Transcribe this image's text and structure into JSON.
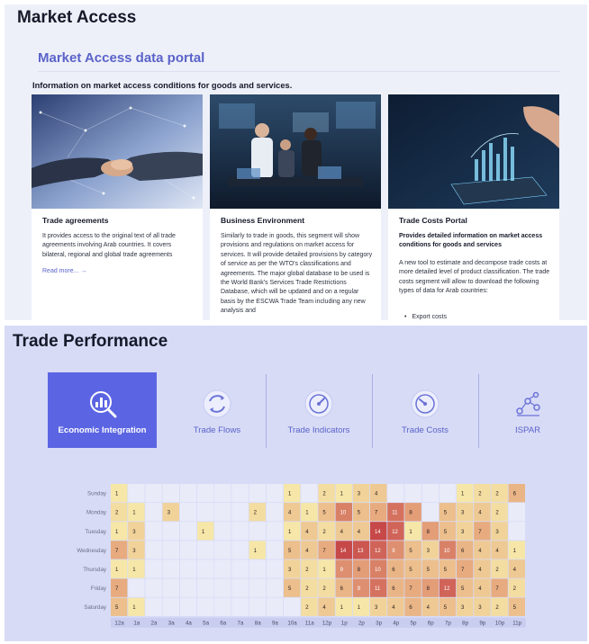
{
  "market_access": {
    "title": "Market Access",
    "portal_title": "Market Access data portal",
    "subtitle": "Information on market access conditions for goods and services.",
    "cards": [
      {
        "title": "Trade agreements",
        "lead": "",
        "body": "It provides access to the original text of all trade agreements involving Arab countries. It covers bilateral, regional and global trade agreements",
        "link": "Read more... →",
        "bullet": ""
      },
      {
        "title": "Business Environment",
        "lead": "",
        "body": "Similarly to trade in goods, this segment will show provisions and regulations on market access for services. It will provide detailed provisions by category of service as per the WTO's classifications and agreements. The major global database to be used is the World Bank's Services Trade Restrictions Database, which will be updated and on a regular basis by the ESCWA Trade Team including any new analysis and",
        "link": "",
        "bullet": ""
      },
      {
        "title": "Trade Costs Portal",
        "lead": "Provides detailed information on market access conditions for goods and services",
        "body": "A new tool to estimate and decompose trade costs at more detailed level of product classification. The trade costs segment will allow to download the following types of data for Arab countries:",
        "link": "",
        "bullet": "Export costs"
      }
    ]
  },
  "trade_performance": {
    "title": "Trade Performance",
    "tabs": [
      {
        "label": "Economic Integration",
        "icon": "bar-chart-magnifier-icon",
        "active": true
      },
      {
        "label": "Trade Flows",
        "icon": "circular-arrows-icon",
        "active": false
      },
      {
        "label": "Trade Indicators",
        "icon": "gauge-icon",
        "active": false
      },
      {
        "label": "Trade Costs",
        "icon": "gauge-icon",
        "active": false
      },
      {
        "label": "ISPAR",
        "icon": "network-chart-icon",
        "active": false
      }
    ]
  },
  "colors": {
    "accent": "#5b65e3",
    "heat_low": "#f6e7a8",
    "heat_mid": "#e8ad80",
    "heat_high": "#c74848",
    "empty_cell": "#e9ebf9"
  },
  "chart_data": {
    "type": "heatmap",
    "x": [
      "12a",
      "1a",
      "2a",
      "3a",
      "4a",
      "5a",
      "6a",
      "7a",
      "8a",
      "9a",
      "10a",
      "11a",
      "12p",
      "1p",
      "2p",
      "3p",
      "4p",
      "5p",
      "6p",
      "7p",
      "8p",
      "9p",
      "10p",
      "11p"
    ],
    "y": [
      "Sunday",
      "Monday",
      "Tuesday",
      "Wednesday",
      "Thursday",
      "Friday",
      "Saturday"
    ],
    "values": [
      [
        1,
        null,
        null,
        null,
        null,
        null,
        null,
        null,
        null,
        null,
        1,
        null,
        2,
        1,
        3,
        4,
        null,
        null,
        null,
        null,
        1,
        2,
        2,
        6
      ],
      [
        2,
        1,
        null,
        3,
        null,
        null,
        null,
        null,
        2,
        null,
        4,
        1,
        5,
        10,
        5,
        7,
        11,
        8,
        null,
        5,
        3,
        4,
        2,
        null
      ],
      [
        1,
        3,
        null,
        null,
        null,
        1,
        null,
        null,
        null,
        null,
        1,
        4,
        2,
        4,
        4,
        14,
        12,
        1,
        8,
        5,
        3,
        7,
        3,
        null
      ],
      [
        7,
        3,
        null,
        null,
        null,
        null,
        null,
        null,
        1,
        null,
        5,
        4,
        7,
        14,
        13,
        12,
        9,
        5,
        3,
        10,
        6,
        4,
        4,
        1
      ],
      [
        1,
        1,
        null,
        null,
        null,
        null,
        null,
        null,
        null,
        null,
        3,
        2,
        1,
        9,
        8,
        10,
        6,
        5,
        5,
        5,
        7,
        4,
        2,
        4
      ],
      [
        7,
        null,
        null,
        null,
        null,
        null,
        null,
        null,
        null,
        null,
        5,
        2,
        2,
        6,
        9,
        11,
        6,
        7,
        8,
        12,
        5,
        4,
        7,
        2
      ],
      [
        5,
        1,
        null,
        null,
        null,
        null,
        null,
        null,
        null,
        null,
        null,
        2,
        4,
        1,
        1,
        3,
        4,
        6,
        4,
        5,
        3,
        3,
        2,
        5
      ]
    ],
    "vmax": 14
  }
}
